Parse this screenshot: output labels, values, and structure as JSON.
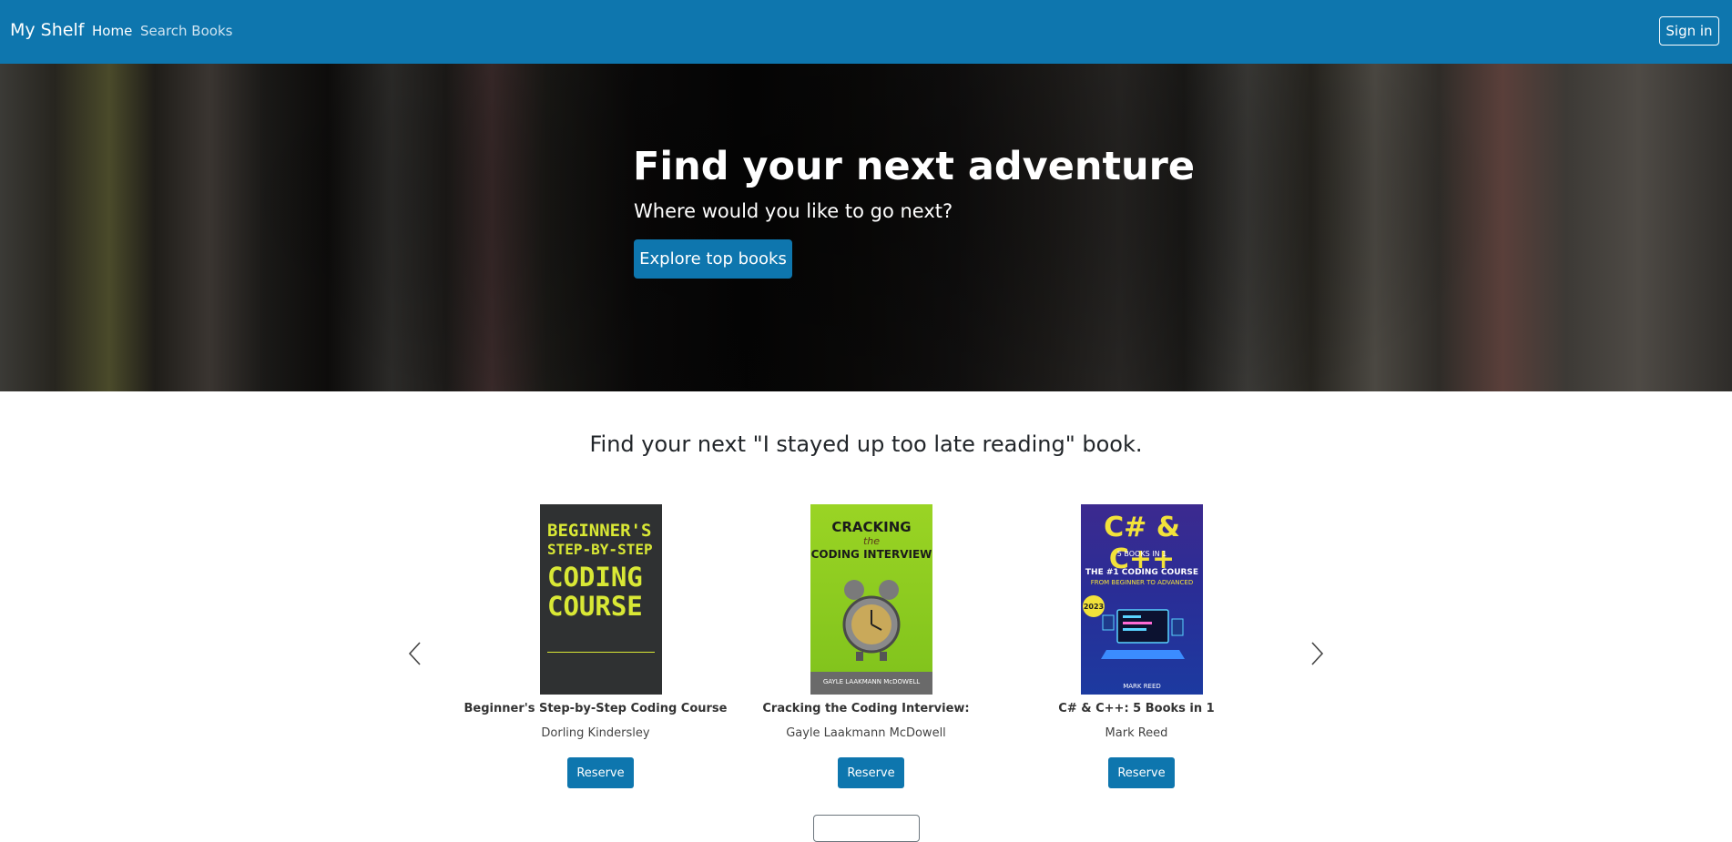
{
  "navbar": {
    "brand": "My Shelf",
    "links": [
      "Home",
      "Search Books"
    ],
    "signin": "Sign in",
    "color": "#0e76ae"
  },
  "hero": {
    "title": "Find your next adventure",
    "subtitle": "Where would you like to go next?",
    "button": "Explore top books"
  },
  "section": {
    "title": "Find your next \"I stayed up too late reading\" book."
  },
  "books": [
    {
      "title": "Beginner's Step-by-Step Coding Course",
      "author": "Dorling Kindersley",
      "button": "Reserve",
      "cover_text": [
        "BEGINNER'S",
        "STEP-BY-STEP",
        "CODING",
        "COURSE"
      ]
    },
    {
      "title": "Cracking the Coding Interview:",
      "author": "Gayle Laakmann McDowell",
      "button": "Reserve",
      "cover_text": [
        "CRACKING",
        "the",
        "CODING INTERVIEW",
        "GAYLE LAAKMANN McDOWELL"
      ]
    },
    {
      "title": "C# & C++: 5 Books in 1",
      "author": "Mark Reed",
      "button": "Reserve",
      "cover_text": [
        "C# & C++",
        "5 BOOKS IN 1",
        "THE #1 CODING COURSE",
        "FROM BEGINNER TO ADVANCED",
        "2023",
        "MARK REED"
      ]
    }
  ],
  "carousel": {
    "prev_icon": "chevron-left-icon",
    "next_icon": "chevron-right-icon"
  }
}
